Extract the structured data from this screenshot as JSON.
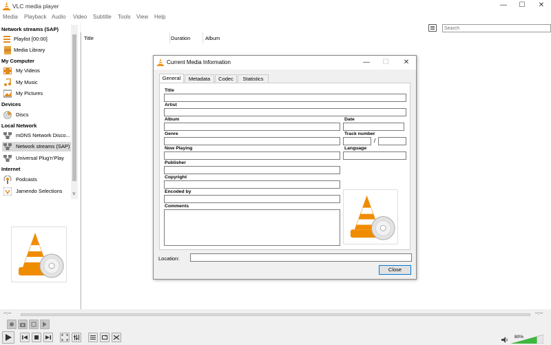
{
  "window": {
    "title": "VLC media player",
    "minimize_glyph": "—",
    "maximize_glyph": "☐",
    "close_glyph": "✕"
  },
  "menu": [
    "Media",
    "Playback",
    "Audio",
    "Video",
    "Subtitle",
    "Tools",
    "View",
    "Help"
  ],
  "sidebar": {
    "header_stream": "Network streams (SAP)",
    "playlist_label": "Playlist [00:00]",
    "media_library_label": "Media Library",
    "my_computer": "My Computer",
    "my_videos": "My Videos",
    "my_music": "My Music",
    "my_pictures": "My Pictures",
    "devices": "Devices",
    "discs": "Discs",
    "local_network": "Local Network",
    "mdns": "mDNS Network Disco...",
    "network_streams": "Network streams (SAP)",
    "upnp": "Universal Plug'n'Play",
    "internet": "Internet",
    "podcasts": "Podcasts",
    "jamendo": "Jamendo Selections",
    "scroll_down_glyph": "˅"
  },
  "playlist": {
    "columns": [
      "Title",
      "Duration",
      "Album"
    ],
    "search_placeholder": "Search"
  },
  "dialog": {
    "title": "Current Media Information",
    "tabs": [
      "General",
      "Metadata",
      "Codec",
      "Statistics"
    ],
    "active_tab": "General",
    "fields": {
      "title": "Title",
      "artist": "Artist",
      "album": "Album",
      "date": "Date",
      "genre": "Genre",
      "track_number": "Track number",
      "track_sep": "/",
      "now_playing": "Now Playing",
      "language": "Language",
      "publisher": "Publisher",
      "copyright": "Copyright",
      "encoded_by": "Encoded by",
      "comments": "Comments"
    },
    "location_label": "Location:",
    "close_button": "Close"
  },
  "player": {
    "time_elapsed": "--:--",
    "time_total": "--:--",
    "volume": "80%",
    "volume_level": 0.8
  },
  "colors": {
    "accent": "#0078d7",
    "vlc_orange": "#f08c00",
    "volume_green": "#3cb83c"
  },
  "icons": [
    "vlc-cone-icon",
    "playlist-icon",
    "media-library-icon",
    "videos-icon",
    "music-icon",
    "pictures-icon",
    "disc-icon",
    "network-icon",
    "podcast-icon",
    "jamendo-icon",
    "play-icon",
    "stop-icon",
    "record-icon",
    "snapshot-icon",
    "loop-icon",
    "shuffle-icon",
    "speaker-icon"
  ]
}
